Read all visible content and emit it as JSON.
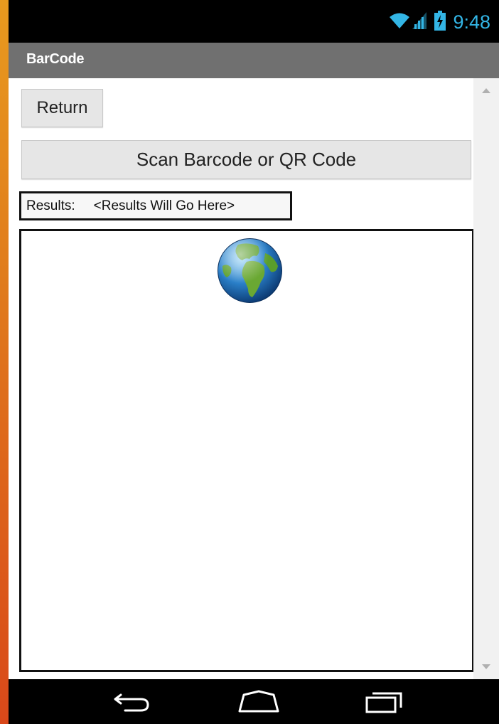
{
  "status_bar": {
    "time": "9:48",
    "icons": [
      "wifi-icon",
      "signal-icon",
      "battery-charging-icon"
    ],
    "accent_color": "#33b5e5"
  },
  "app_bar": {
    "title": "BarCode"
  },
  "buttons": {
    "return_label": "Return",
    "scan_label": "Scan Barcode or QR Code"
  },
  "results": {
    "label": "Results:",
    "value": "<Results Will Go Here>"
  },
  "canvas": {
    "image": "globe-icon"
  },
  "nav_bar": {
    "icons": [
      "back-icon",
      "home-icon",
      "recent-apps-icon"
    ]
  }
}
